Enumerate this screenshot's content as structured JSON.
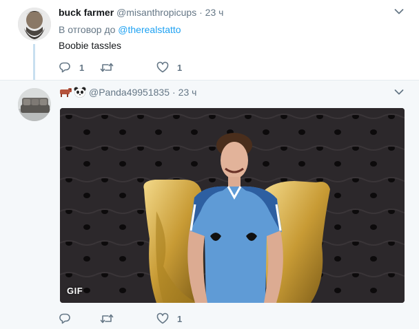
{
  "tweet1": {
    "name": "buck farmer",
    "handle": "@misanthropicups",
    "separator": "·",
    "time": "23 ч",
    "reply_prefix": "В отговор до",
    "reply_mention": "@therealstatto",
    "text": "Boobie tassles",
    "reply_count": "1",
    "retweet_count": "",
    "like_count": "1"
  },
  "tweet2": {
    "handle": "@Panda49951835",
    "separator": "·",
    "time": "23 ч",
    "gif_label": "GIF",
    "reply_count": "",
    "retweet_count": "",
    "like_count": "1"
  },
  "colors": {
    "accent": "#1da1f2",
    "secondary_text": "#657786",
    "reply_background": "#f5f8fa"
  },
  "icons": [
    "reply-icon",
    "retweet-icon",
    "heart-icon",
    "caret-down-icon",
    "cow-emoji",
    "panda-emoji"
  ]
}
